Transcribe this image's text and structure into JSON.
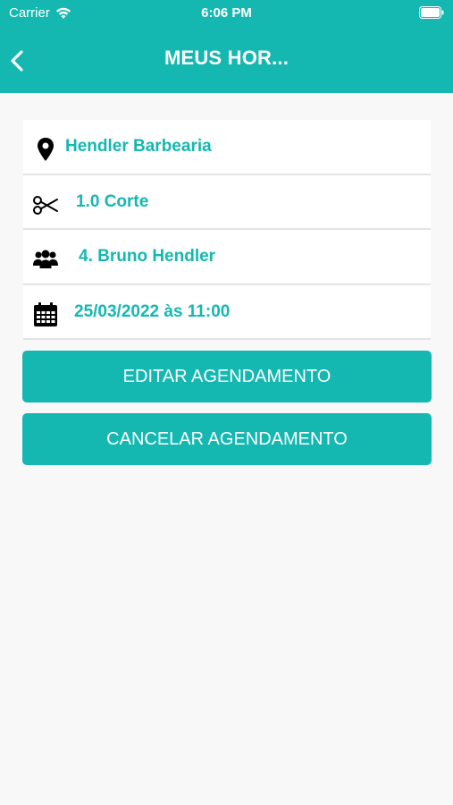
{
  "status_bar": {
    "carrier": "Carrier",
    "time": "6:06 PM"
  },
  "nav": {
    "title": "MEUS HOR..."
  },
  "details": {
    "location": "Hendler Barbearia",
    "service": "1.0 Corte",
    "professional": "4. Bruno Hendler",
    "datetime": "25/03/2022 às 11:00"
  },
  "actions": {
    "edit_label": "EDITAR AGENDAMENTO",
    "cancel_label": "CANCELAR AGENDAMENTO"
  },
  "colors": {
    "accent": "#14b8b1",
    "background": "#f8f8f8"
  }
}
